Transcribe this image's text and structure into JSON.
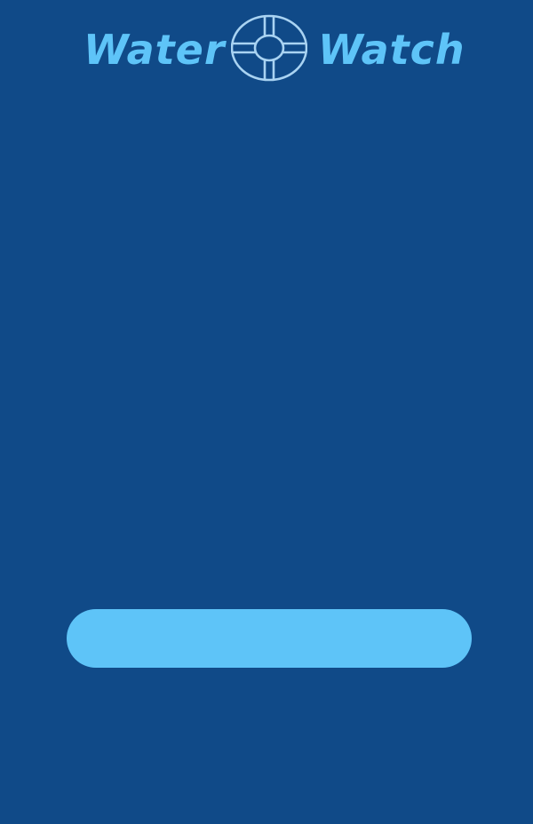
{
  "header": {
    "brand_left": "Water",
    "brand_right": "Watch",
    "logo_icon": "lifebuoy-icon"
  },
  "main": {
    "button_label": ""
  },
  "colors": {
    "background": "#104a88",
    "accent": "#5ec4f8",
    "logo_stroke": "#a9d3f2"
  }
}
